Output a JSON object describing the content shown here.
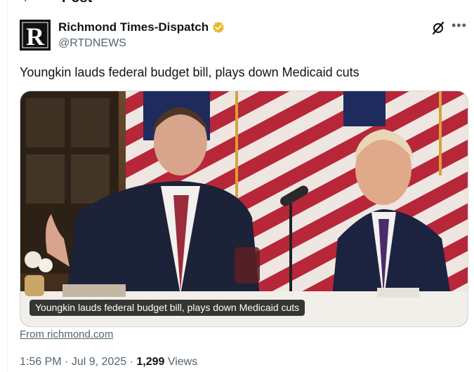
{
  "header": {
    "title": "Post"
  },
  "author": {
    "name": "Richmond Times-Dispatch",
    "handle": "@RTDNEWS",
    "avatar_letter": "R"
  },
  "tweet": {
    "text": "Youngkin lauds federal budget bill, plays down Medicaid cuts"
  },
  "media": {
    "caption": "Youngkin lauds federal budget bill, plays down Medicaid cuts"
  },
  "source": {
    "label": "From richmond.com"
  },
  "meta": {
    "time": "1:56 PM",
    "separator": "·",
    "date": "Jul 9, 2025",
    "views_count": "1,299",
    "views_label": "Views"
  },
  "icons": {
    "back": "arrow-left-icon",
    "verified": "verified-badge-icon",
    "grok": "grok-icon",
    "more": "more-icon"
  },
  "colors": {
    "verified_gold": "#e8b829",
    "muted": "#536471",
    "text": "#0f1419"
  }
}
